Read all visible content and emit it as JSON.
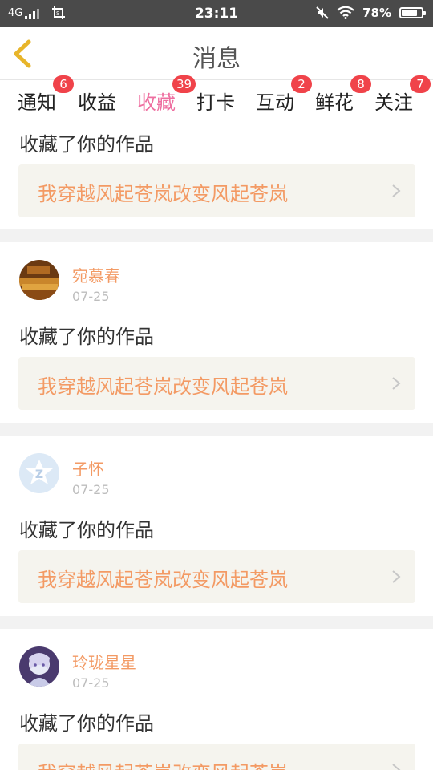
{
  "status": {
    "network": "4G",
    "time": "23:11",
    "battery": "78%",
    "battery_level": 0.78
  },
  "header": {
    "title": "消息",
    "back_icon": "back-chevron-icon"
  },
  "tabs": [
    {
      "label": "通知",
      "badge": "6"
    },
    {
      "label": "收益",
      "badge": ""
    },
    {
      "label": "收藏",
      "badge": "39"
    },
    {
      "label": "打卡",
      "badge": ""
    },
    {
      "label": "互动",
      "badge": "2"
    },
    {
      "label": "鲜花",
      "badge": "8"
    },
    {
      "label": "关注",
      "badge": "7"
    }
  ],
  "active_tab": "收藏",
  "colors": {
    "accent": "#ee6fa0",
    "badge": "#f0434a",
    "work_title": "#f39a64"
  },
  "items": [
    {
      "user": "",
      "date": "",
      "action": "收藏了你的作品",
      "work": "我穿越风起苍岚改变风起苍岚"
    },
    {
      "user": "宛慕春",
      "date": "07-25",
      "action": "收藏了你的作品",
      "work": "我穿越风起苍岚改变风起苍岚"
    },
    {
      "user": "子怀",
      "date": "07-25",
      "action": "收藏了你的作品",
      "work": "我穿越风起苍岚改变风起苍岚"
    },
    {
      "user": "玲珑星星",
      "date": "07-25",
      "action": "收藏了你的作品",
      "work": "我穿越风起苍岚改变风起苍岚"
    }
  ]
}
